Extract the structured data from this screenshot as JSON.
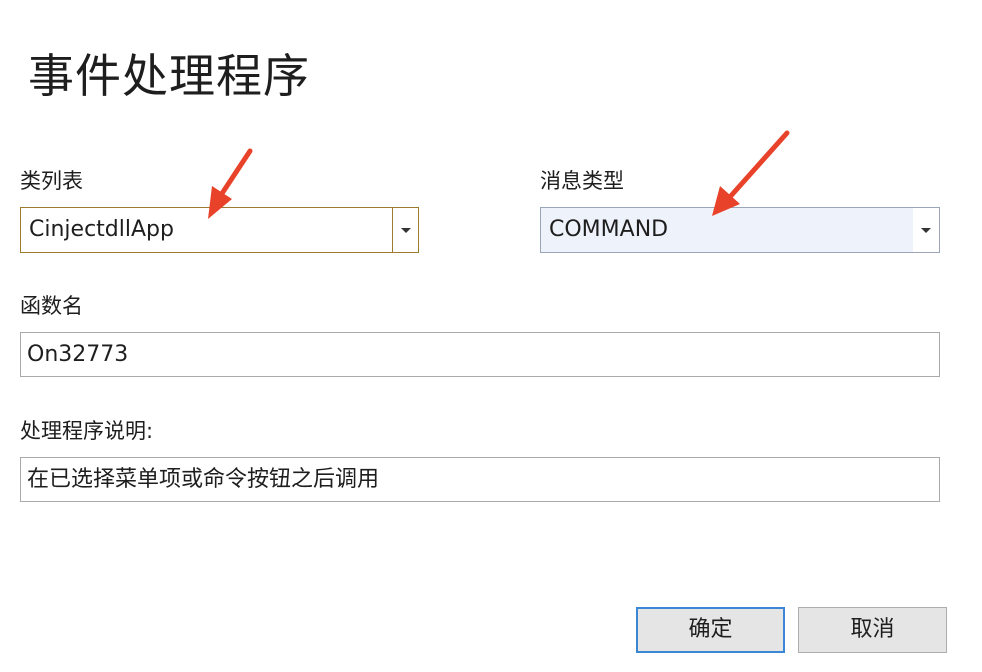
{
  "dialog": {
    "title": "事件处理程序"
  },
  "class_list": {
    "label": "类列表",
    "value": "CinjectdllApp"
  },
  "message_type": {
    "label": "消息类型",
    "value": "COMMAND"
  },
  "function_name": {
    "label": "函数名",
    "value": "On32773"
  },
  "handler_description": {
    "label": "处理程序说明:",
    "value": "在已选择菜单项或命令按钮之后调用"
  },
  "buttons": {
    "ok": "确定",
    "cancel": "取消"
  },
  "colors": {
    "annotation_arrow": "#e8432a",
    "focus_border": "#3a87d6"
  },
  "icons": {
    "dropdown": "chevron-down-icon",
    "annotation": "red-arrow-icon"
  }
}
